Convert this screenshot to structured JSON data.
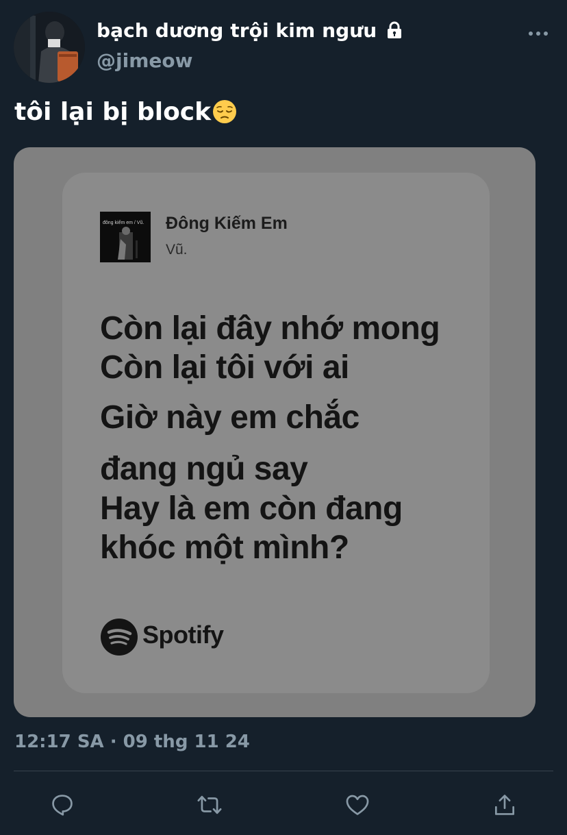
{
  "author": {
    "display_name": "bạch dương trội kim ngưu",
    "handle": "@jimeow",
    "protected": true
  },
  "tweet": {
    "text": "tôi lại bị block",
    "emoji": "pensive-face"
  },
  "media": {
    "song_title": "Đông Kiếm Em",
    "artist": "Vũ.",
    "album_art_caption": "đông kiếm em / Vũ.",
    "lyrics": [
      "Còn lại đây nhớ mong",
      "Còn lại tôi với ai",
      "Giờ này em chắc",
      "đang ngủ say",
      "Hay là em còn đang",
      "khóc một mình?"
    ],
    "brand": "Spotify"
  },
  "timestamp": "12:17 SA · 09 thg 11 24",
  "actions": {
    "reply": "reply-icon",
    "retweet": "retweet-icon",
    "like": "like-icon",
    "share": "share-icon"
  },
  "colors": {
    "background": "#15202b",
    "secondary_text": "#8899a6",
    "divider": "#38444d"
  }
}
